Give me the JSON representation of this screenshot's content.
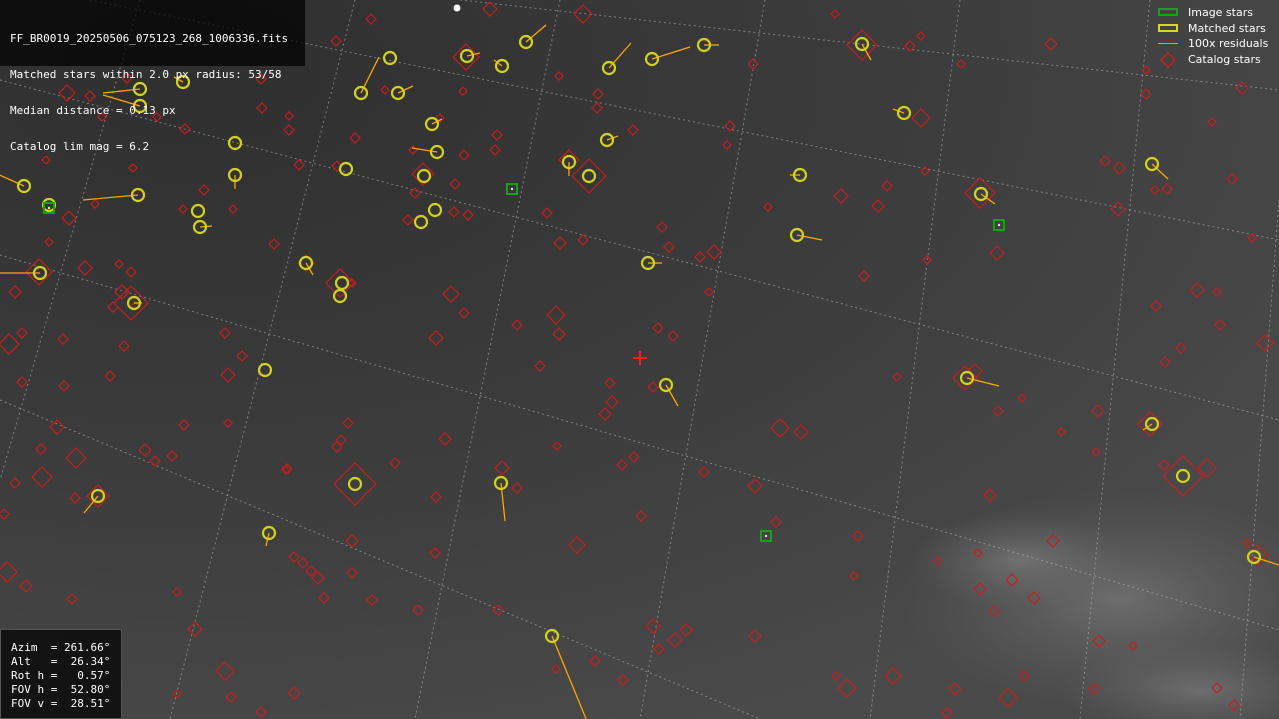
{
  "file_info": {
    "filename": "FF_BR0019_20250506_075123_268_1006336.fits",
    "matched_line": "Matched stars within 2.0 px radius: 53/58",
    "median_line": "Median distance = 0.13 px",
    "catalog_line": "Catalog lim mag = 6.2"
  },
  "legend": {
    "image_stars": "Image stars",
    "matched_stars": "Matched stars",
    "residuals": "100x residuals",
    "catalog_stars": "Catalog stars"
  },
  "pointing": {
    "azim": "Azim  = 261.66°",
    "alt": "Alt   =  26.34°",
    "rot": "Rot h =   0.57°",
    "fov_h": "FOV h =  52.80°",
    "fov_v": "FOV v =  28.51°"
  },
  "colors": {
    "catalog": "#c81e1e",
    "matched": "#d2d21e",
    "image": "#19a019",
    "residual": "#ffa500",
    "grid": "#bdbdbd",
    "center": "#ff1a1a"
  },
  "icons": {
    "center": "red-cross-icon",
    "catalog": "diamond-icon",
    "matched": "circle-icon",
    "image": "square-icon"
  }
}
